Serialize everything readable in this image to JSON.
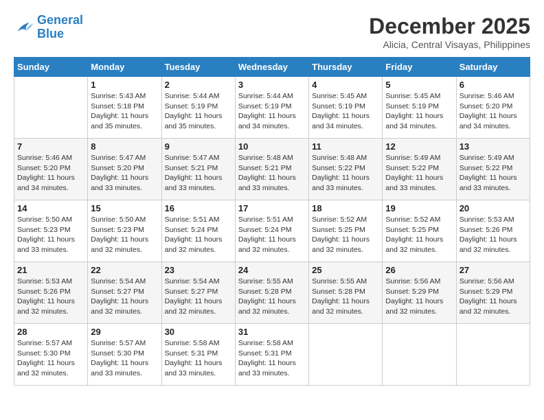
{
  "header": {
    "logo_line1": "General",
    "logo_line2": "Blue",
    "month": "December 2025",
    "location": "Alicia, Central Visayas, Philippines"
  },
  "days_of_week": [
    "Sunday",
    "Monday",
    "Tuesday",
    "Wednesday",
    "Thursday",
    "Friday",
    "Saturday"
  ],
  "weeks": [
    [
      {
        "day": "",
        "sunrise": "",
        "sunset": "",
        "daylight": "",
        "empty": true
      },
      {
        "day": "1",
        "sunrise": "Sunrise: 5:43 AM",
        "sunset": "Sunset: 5:18 PM",
        "daylight": "Daylight: 11 hours and 35 minutes."
      },
      {
        "day": "2",
        "sunrise": "Sunrise: 5:44 AM",
        "sunset": "Sunset: 5:19 PM",
        "daylight": "Daylight: 11 hours and 35 minutes."
      },
      {
        "day": "3",
        "sunrise": "Sunrise: 5:44 AM",
        "sunset": "Sunset: 5:19 PM",
        "daylight": "Daylight: 11 hours and 34 minutes."
      },
      {
        "day": "4",
        "sunrise": "Sunrise: 5:45 AM",
        "sunset": "Sunset: 5:19 PM",
        "daylight": "Daylight: 11 hours and 34 minutes."
      },
      {
        "day": "5",
        "sunrise": "Sunrise: 5:45 AM",
        "sunset": "Sunset: 5:19 PM",
        "daylight": "Daylight: 11 hours and 34 minutes."
      },
      {
        "day": "6",
        "sunrise": "Sunrise: 5:46 AM",
        "sunset": "Sunset: 5:20 PM",
        "daylight": "Daylight: 11 hours and 34 minutes."
      }
    ],
    [
      {
        "day": "7",
        "sunrise": "Sunrise: 5:46 AM",
        "sunset": "Sunset: 5:20 PM",
        "daylight": "Daylight: 11 hours and 34 minutes."
      },
      {
        "day": "8",
        "sunrise": "Sunrise: 5:47 AM",
        "sunset": "Sunset: 5:20 PM",
        "daylight": "Daylight: 11 hours and 33 minutes."
      },
      {
        "day": "9",
        "sunrise": "Sunrise: 5:47 AM",
        "sunset": "Sunset: 5:21 PM",
        "daylight": "Daylight: 11 hours and 33 minutes."
      },
      {
        "day": "10",
        "sunrise": "Sunrise: 5:48 AM",
        "sunset": "Sunset: 5:21 PM",
        "daylight": "Daylight: 11 hours and 33 minutes."
      },
      {
        "day": "11",
        "sunrise": "Sunrise: 5:48 AM",
        "sunset": "Sunset: 5:22 PM",
        "daylight": "Daylight: 11 hours and 33 minutes."
      },
      {
        "day": "12",
        "sunrise": "Sunrise: 5:49 AM",
        "sunset": "Sunset: 5:22 PM",
        "daylight": "Daylight: 11 hours and 33 minutes."
      },
      {
        "day": "13",
        "sunrise": "Sunrise: 5:49 AM",
        "sunset": "Sunset: 5:22 PM",
        "daylight": "Daylight: 11 hours and 33 minutes."
      }
    ],
    [
      {
        "day": "14",
        "sunrise": "Sunrise: 5:50 AM",
        "sunset": "Sunset: 5:23 PM",
        "daylight": "Daylight: 11 hours and 33 minutes."
      },
      {
        "day": "15",
        "sunrise": "Sunrise: 5:50 AM",
        "sunset": "Sunset: 5:23 PM",
        "daylight": "Daylight: 11 hours and 32 minutes."
      },
      {
        "day": "16",
        "sunrise": "Sunrise: 5:51 AM",
        "sunset": "Sunset: 5:24 PM",
        "daylight": "Daylight: 11 hours and 32 minutes."
      },
      {
        "day": "17",
        "sunrise": "Sunrise: 5:51 AM",
        "sunset": "Sunset: 5:24 PM",
        "daylight": "Daylight: 11 hours and 32 minutes."
      },
      {
        "day": "18",
        "sunrise": "Sunrise: 5:52 AM",
        "sunset": "Sunset: 5:25 PM",
        "daylight": "Daylight: 11 hours and 32 minutes."
      },
      {
        "day": "19",
        "sunrise": "Sunrise: 5:52 AM",
        "sunset": "Sunset: 5:25 PM",
        "daylight": "Daylight: 11 hours and 32 minutes."
      },
      {
        "day": "20",
        "sunrise": "Sunrise: 5:53 AM",
        "sunset": "Sunset: 5:26 PM",
        "daylight": "Daylight: 11 hours and 32 minutes."
      }
    ],
    [
      {
        "day": "21",
        "sunrise": "Sunrise: 5:53 AM",
        "sunset": "Sunset: 5:26 PM",
        "daylight": "Daylight: 11 hours and 32 minutes."
      },
      {
        "day": "22",
        "sunrise": "Sunrise: 5:54 AM",
        "sunset": "Sunset: 5:27 PM",
        "daylight": "Daylight: 11 hours and 32 minutes."
      },
      {
        "day": "23",
        "sunrise": "Sunrise: 5:54 AM",
        "sunset": "Sunset: 5:27 PM",
        "daylight": "Daylight: 11 hours and 32 minutes."
      },
      {
        "day": "24",
        "sunrise": "Sunrise: 5:55 AM",
        "sunset": "Sunset: 5:28 PM",
        "daylight": "Daylight: 11 hours and 32 minutes."
      },
      {
        "day": "25",
        "sunrise": "Sunrise: 5:55 AM",
        "sunset": "Sunset: 5:28 PM",
        "daylight": "Daylight: 11 hours and 32 minutes."
      },
      {
        "day": "26",
        "sunrise": "Sunrise: 5:56 AM",
        "sunset": "Sunset: 5:29 PM",
        "daylight": "Daylight: 11 hours and 32 minutes."
      },
      {
        "day": "27",
        "sunrise": "Sunrise: 5:56 AM",
        "sunset": "Sunset: 5:29 PM",
        "daylight": "Daylight: 11 hours and 32 minutes."
      }
    ],
    [
      {
        "day": "28",
        "sunrise": "Sunrise: 5:57 AM",
        "sunset": "Sunset: 5:30 PM",
        "daylight": "Daylight: 11 hours and 32 minutes."
      },
      {
        "day": "29",
        "sunrise": "Sunrise: 5:57 AM",
        "sunset": "Sunset: 5:30 PM",
        "daylight": "Daylight: 11 hours and 33 minutes."
      },
      {
        "day": "30",
        "sunrise": "Sunrise: 5:58 AM",
        "sunset": "Sunset: 5:31 PM",
        "daylight": "Daylight: 11 hours and 33 minutes."
      },
      {
        "day": "31",
        "sunrise": "Sunrise: 5:58 AM",
        "sunset": "Sunset: 5:31 PM",
        "daylight": "Daylight: 11 hours and 33 minutes."
      },
      {
        "day": "",
        "sunrise": "",
        "sunset": "",
        "daylight": "",
        "empty": true
      },
      {
        "day": "",
        "sunrise": "",
        "sunset": "",
        "daylight": "",
        "empty": true
      },
      {
        "day": "",
        "sunrise": "",
        "sunset": "",
        "daylight": "",
        "empty": true
      }
    ]
  ]
}
